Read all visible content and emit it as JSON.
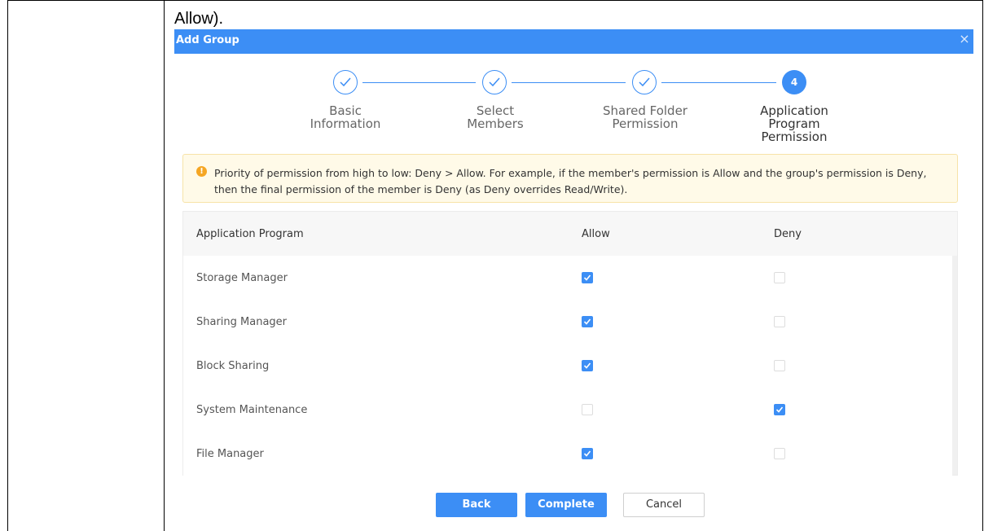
{
  "caption": "Allow).",
  "dialog": {
    "title": "Add Group",
    "close_glyph": "×"
  },
  "steps": [
    {
      "label": "Basic\nInformation",
      "state": "done"
    },
    {
      "label": "Select\nMembers",
      "state": "done"
    },
    {
      "label": "Shared Folder\nPermission",
      "state": "done"
    },
    {
      "label": "Application\nProgram\nPermission",
      "state": "current",
      "number": "4"
    }
  ],
  "notice": {
    "icon": "warning-icon",
    "icon_glyph": "!",
    "text": "Priority of permission from high to low: Deny > Allow. For example, if the member's permission is Allow and the group's permission is Deny, then the final permission of the member is Deny (as Deny overrides Read/Write)."
  },
  "table": {
    "headers": {
      "program": "Application Program",
      "allow": "Allow",
      "deny": "Deny"
    },
    "rows": [
      {
        "name": "Storage Manager",
        "allow": true,
        "deny": false
      },
      {
        "name": "Sharing Manager",
        "allow": true,
        "deny": false
      },
      {
        "name": "Block Sharing",
        "allow": true,
        "deny": false
      },
      {
        "name": "System Maintenance",
        "allow": false,
        "deny": true
      },
      {
        "name": "File Manager",
        "allow": true,
        "deny": false
      }
    ]
  },
  "buttons": {
    "back": "Back",
    "complete": "Complete",
    "cancel": "Cancel"
  },
  "colors": {
    "accent": "#3c8ef5",
    "notice_bg": "#fffae8",
    "warning": "#f5a623"
  }
}
